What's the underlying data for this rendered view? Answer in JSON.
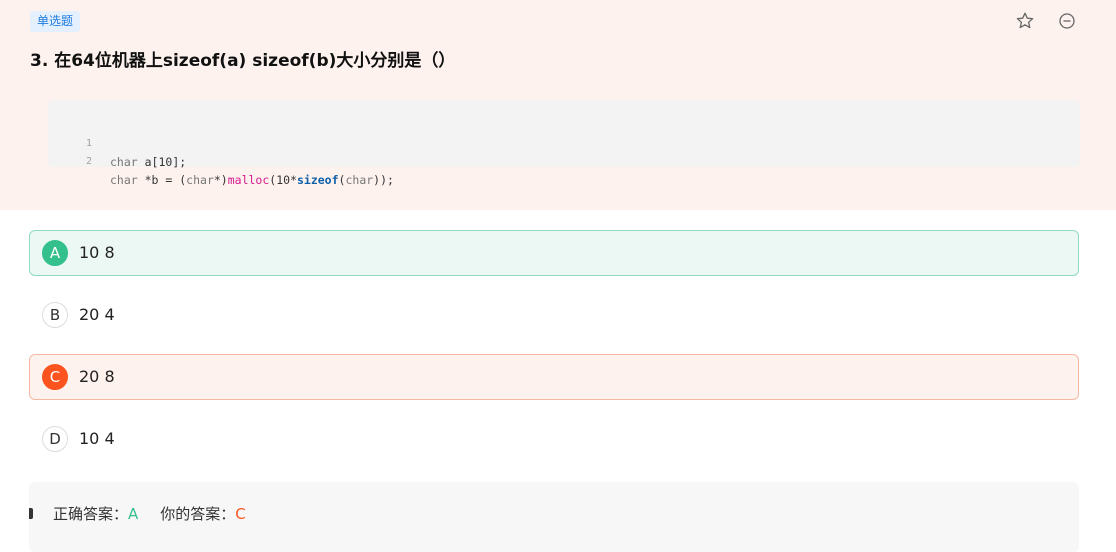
{
  "question": {
    "type_tag": "单选题",
    "title": "3. 在64位机器上sizeof(a)  sizeof(b)大小分别是（）",
    "code_lines": [
      {
        "number": "1"
      },
      {
        "number": "2"
      }
    ],
    "code": {
      "line1": {
        "kw": "char",
        "rest": " a[10];"
      },
      "line2": {
        "kw1": "char",
        "part1": " *b = (",
        "kw2": "char",
        "part2": "*)",
        "fn": "malloc",
        "part3": "(10*",
        "op": "sizeof",
        "part4": "(",
        "kw3": "char",
        "part5": "));"
      }
    }
  },
  "toolbar": {
    "favorite_icon": "star-icon",
    "collapse_icon": "minus-circle-icon"
  },
  "options": [
    {
      "letter": "A",
      "text": "10 8",
      "state": "correct"
    },
    {
      "letter": "B",
      "text": "20 4",
      "state": "normal"
    },
    {
      "letter": "C",
      "text": "20 8",
      "state": "wrong"
    },
    {
      "letter": "D",
      "text": "10 4",
      "state": "normal"
    }
  ],
  "answer": {
    "correct_label": "正确答案：",
    "correct_value": "A",
    "yours_label": "你的答案：",
    "yours_value": "C"
  },
  "colors": {
    "correct": "#33c08d",
    "wrong": "#fd541f",
    "tag_blue": "#1e7be0",
    "panel_bg": "#fdf2ee"
  }
}
